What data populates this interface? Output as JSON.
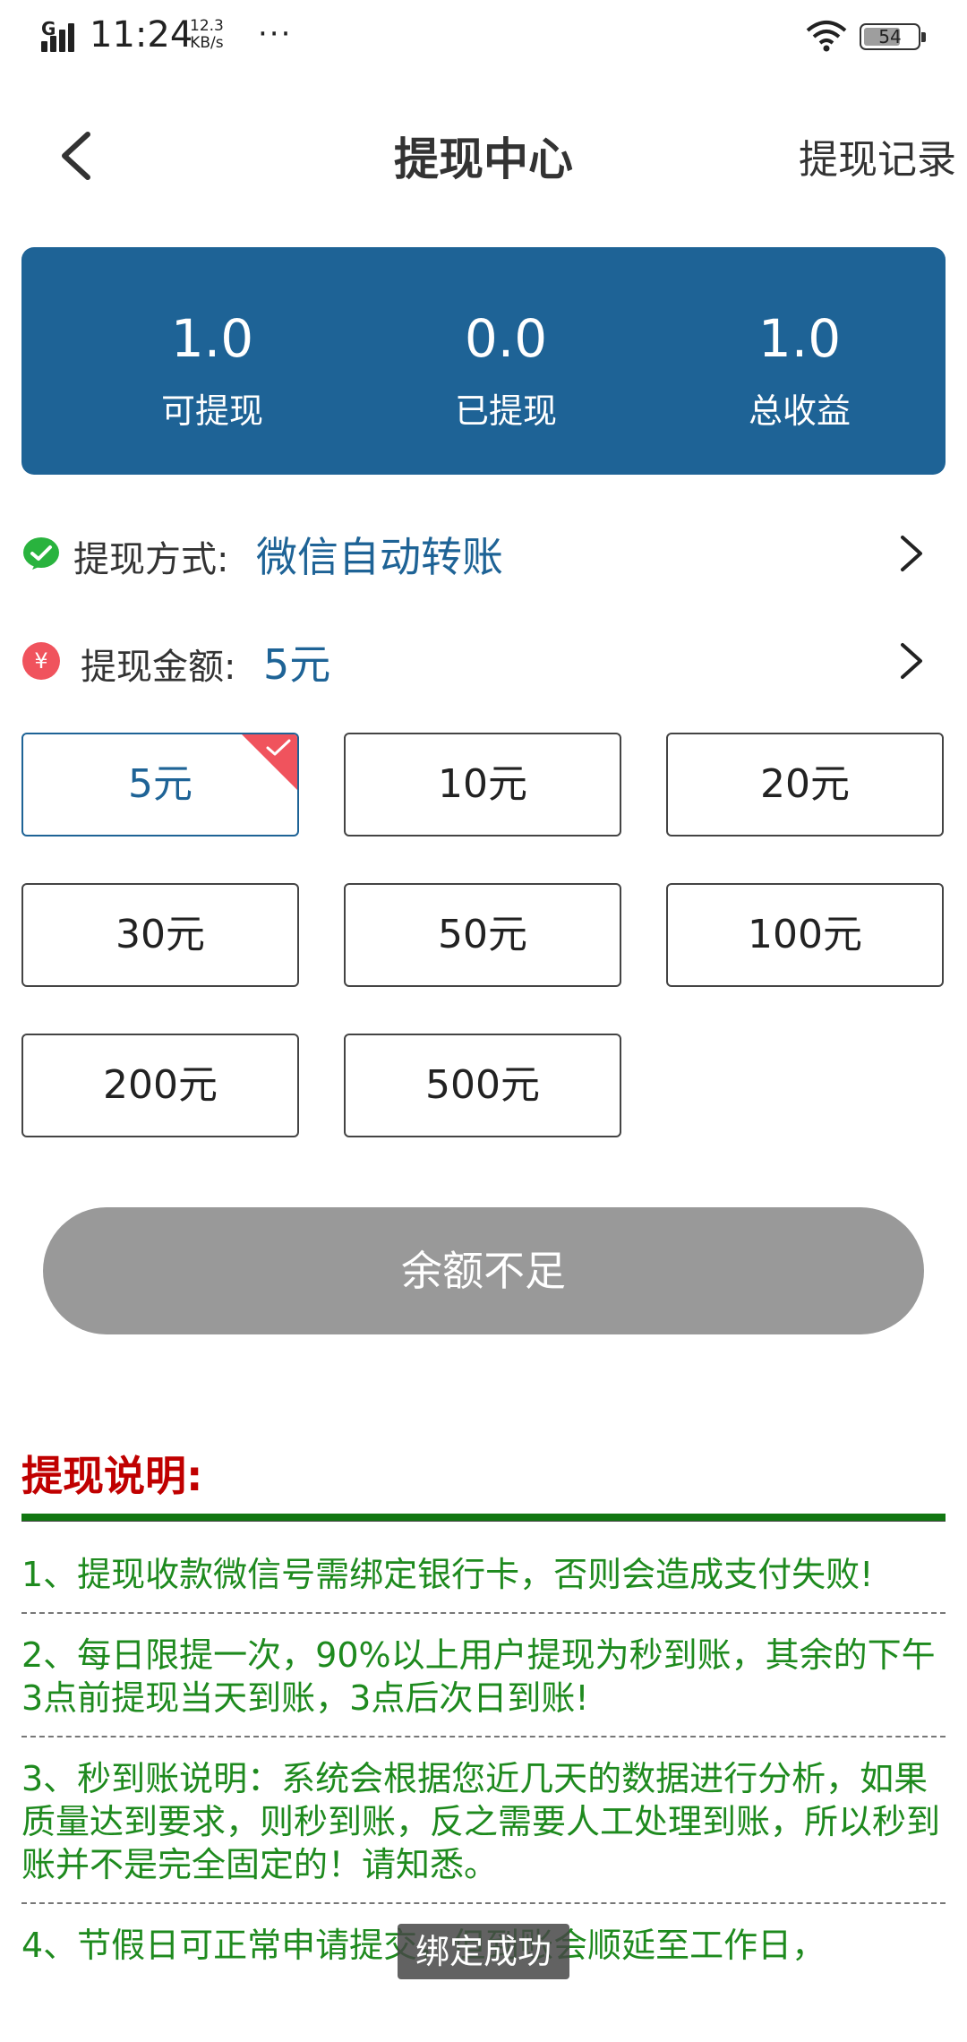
{
  "status_bar": {
    "network": "G",
    "time": "11:24",
    "speed_value": "12.3",
    "speed_unit": "KB/s",
    "more": "···",
    "battery": "54"
  },
  "nav": {
    "title": "提现中心",
    "record": "提现记录"
  },
  "summary": {
    "withdrawable": {
      "value": "1.0",
      "label": "可提现"
    },
    "withdrawn": {
      "value": "0.0",
      "label": "已提现"
    },
    "total": {
      "value": "1.0",
      "label": "总收益"
    },
    "bg_color": "#1e6396"
  },
  "method": {
    "label": "提现方式:",
    "value": "微信自动转账",
    "icon": "wechat-icon"
  },
  "amount": {
    "label": "提现金额:",
    "value": "5元",
    "icon": "yen-icon"
  },
  "amount_options": {
    "o5": "5元",
    "o10": "10元",
    "o20": "20元",
    "o30": "30元",
    "o50": "50元",
    "o100": "100元",
    "o200": "200元",
    "o500": "500元",
    "selected": "5元"
  },
  "submit": {
    "label": "余额不足"
  },
  "instructions": {
    "title": "提现说明:",
    "items": [
      "1、提现收款微信号需绑定银行卡，否则会造成支付失败!",
      "2、每日限提一次，90%以上用户提现为秒到账，其余的下午3点前提现当天到账，3点后次日到账!",
      "3、秒到账说明：系统会根据您近几天的数据进行分析，如果质量达到要求，则秒到账，反之需要人工处理到账，所以秒到账并不是完全固定的！请知悉。",
      "4、节假日可正常申请提交，但到账会顺延至工作日，"
    ]
  },
  "toast": "绑定成功",
  "colors": {
    "accent": "#1e6396",
    "instruction_title": "#c00000",
    "instruction_text": "#1e8a1e",
    "selected_badge": "#f0535d"
  }
}
